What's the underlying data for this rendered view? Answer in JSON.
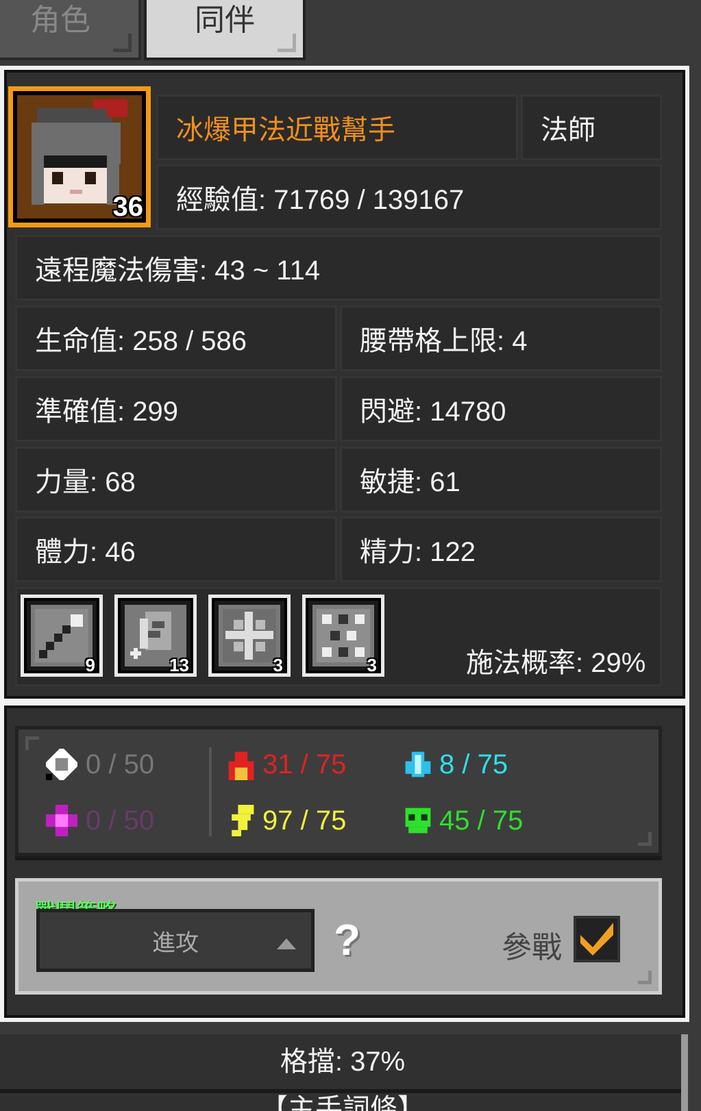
{
  "tabs": [
    {
      "label": "角色"
    },
    {
      "label": "同伴"
    }
  ],
  "companion": {
    "name": "冰爆甲法近戰幫手",
    "class": "法師",
    "level": "36",
    "experience": "經驗值: 71769 / 139167",
    "ranged_damage": "遠程魔法傷害: 43 ~ 114"
  },
  "stats": {
    "hp": "生命值: 258 / 586",
    "belt": "腰帶格上限: 4",
    "accuracy": "準確值: 299",
    "dodge": "閃避: 14780",
    "strength": "力量: 68",
    "agility": "敏捷: 61",
    "vitality": "體力: 46",
    "energy": "精力: 122"
  },
  "skills": {
    "slots": [
      {
        "icon": "staff-icon",
        "count": "9"
      },
      {
        "icon": "shield-icon",
        "count": "13"
      },
      {
        "icon": "burst-icon",
        "count": "3"
      },
      {
        "icon": "rune-icon",
        "count": "3"
      }
    ],
    "cast_chance": "施法概率: 29%"
  },
  "resistances": {
    "physical": {
      "value": "0 / 50",
      "color": "#777777"
    },
    "magic": {
      "value": "0 / 50",
      "color": "#6a3a6a"
    },
    "fire": {
      "value": "31 / 75",
      "color": "#e02222"
    },
    "lightning": {
      "value": "97 / 75",
      "color": "#f2f23c"
    },
    "ice": {
      "value": "8 / 75",
      "color": "#2ee0ea"
    },
    "poison": {
      "value": "45 / 75",
      "color": "#2ee02e"
    }
  },
  "strategy": {
    "label": "戰鬥策略",
    "selected": "進攻",
    "help": "?",
    "participate_label": "參戰",
    "participate_checked": true
  },
  "bottom": {
    "block": "格擋: 37%",
    "next_section": "【主手詞條】"
  }
}
